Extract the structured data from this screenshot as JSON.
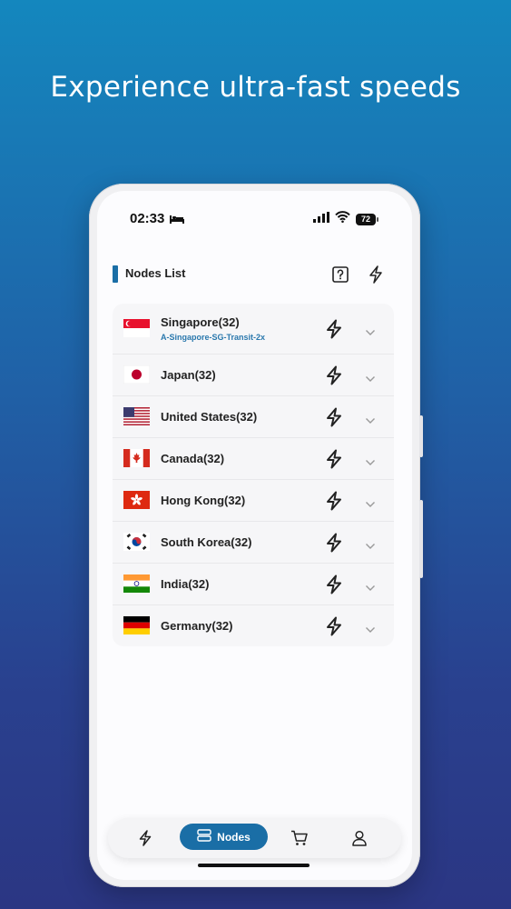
{
  "headline": "Experience ultra-fast speeds",
  "status": {
    "time": "02:33",
    "battery": "72"
  },
  "header": {
    "title": "Nodes List",
    "help_icon": "help-square-icon",
    "speed_icon": "lightning-icon"
  },
  "nodes": [
    {
      "name": "Singapore(32)",
      "sub": "A-Singapore-SG-Transit-2x"
    },
    {
      "name": "Japan(32)"
    },
    {
      "name": "United States(32)"
    },
    {
      "name": "Canada(32)"
    },
    {
      "name": "Hong Kong(32)"
    },
    {
      "name": "South Korea(32)"
    },
    {
      "name": "India(32)"
    },
    {
      "name": "Germany(32)"
    }
  ],
  "nav": {
    "active_label": "Nodes"
  },
  "colors": {
    "accent": "#1a6ea6",
    "subtext": "#2a78ad"
  }
}
